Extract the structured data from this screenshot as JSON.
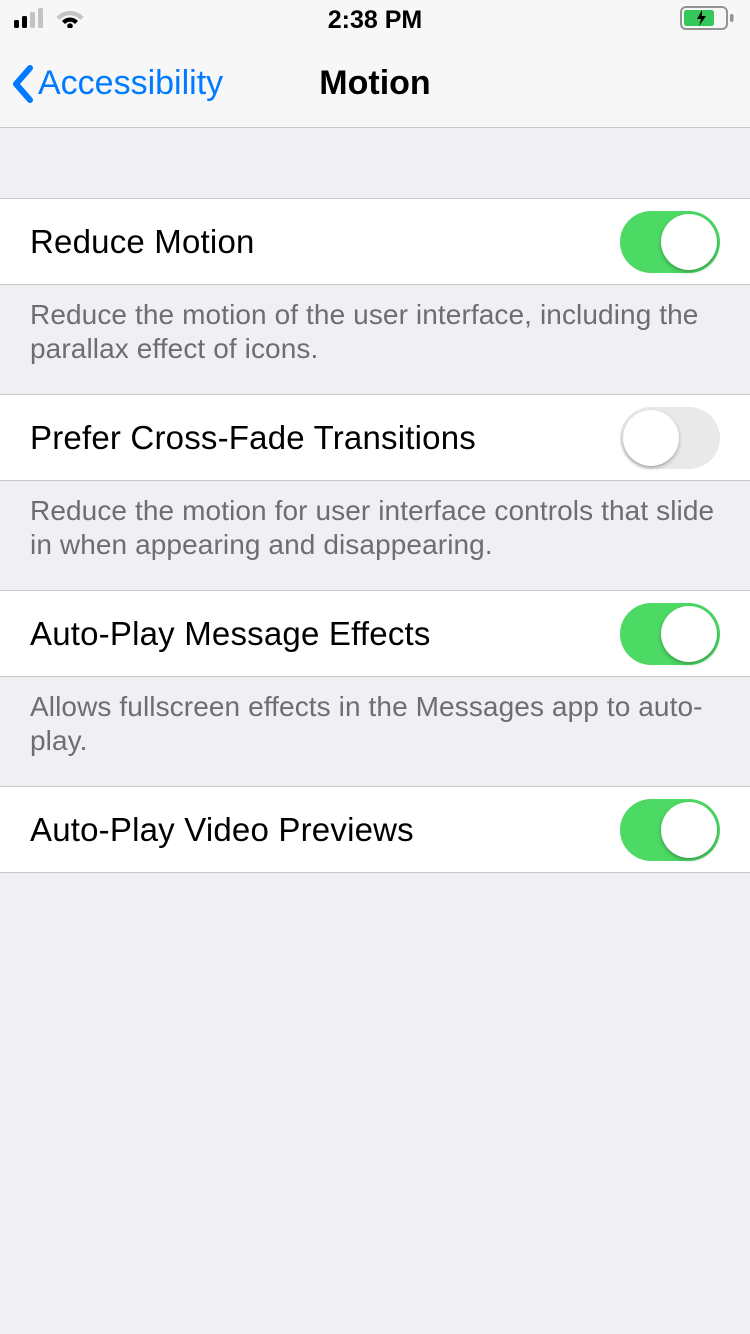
{
  "status": {
    "time": "2:38 PM"
  },
  "nav": {
    "back_label": "Accessibility",
    "title": "Motion"
  },
  "rows": {
    "reduce_motion": {
      "label": "Reduce Motion",
      "on": true,
      "footer": "Reduce the motion of the user interface, including the parallax effect of icons."
    },
    "cross_fade": {
      "label": "Prefer Cross-Fade Transitions",
      "on": false,
      "footer": "Reduce the motion for user interface controls that slide in when appearing and disappearing."
    },
    "autoplay_messages": {
      "label": "Auto-Play Message Effects",
      "on": true,
      "footer": "Allows fullscreen effects in the Messages app to auto-play."
    },
    "autoplay_video": {
      "label": "Auto-Play Video Previews",
      "on": true
    }
  }
}
